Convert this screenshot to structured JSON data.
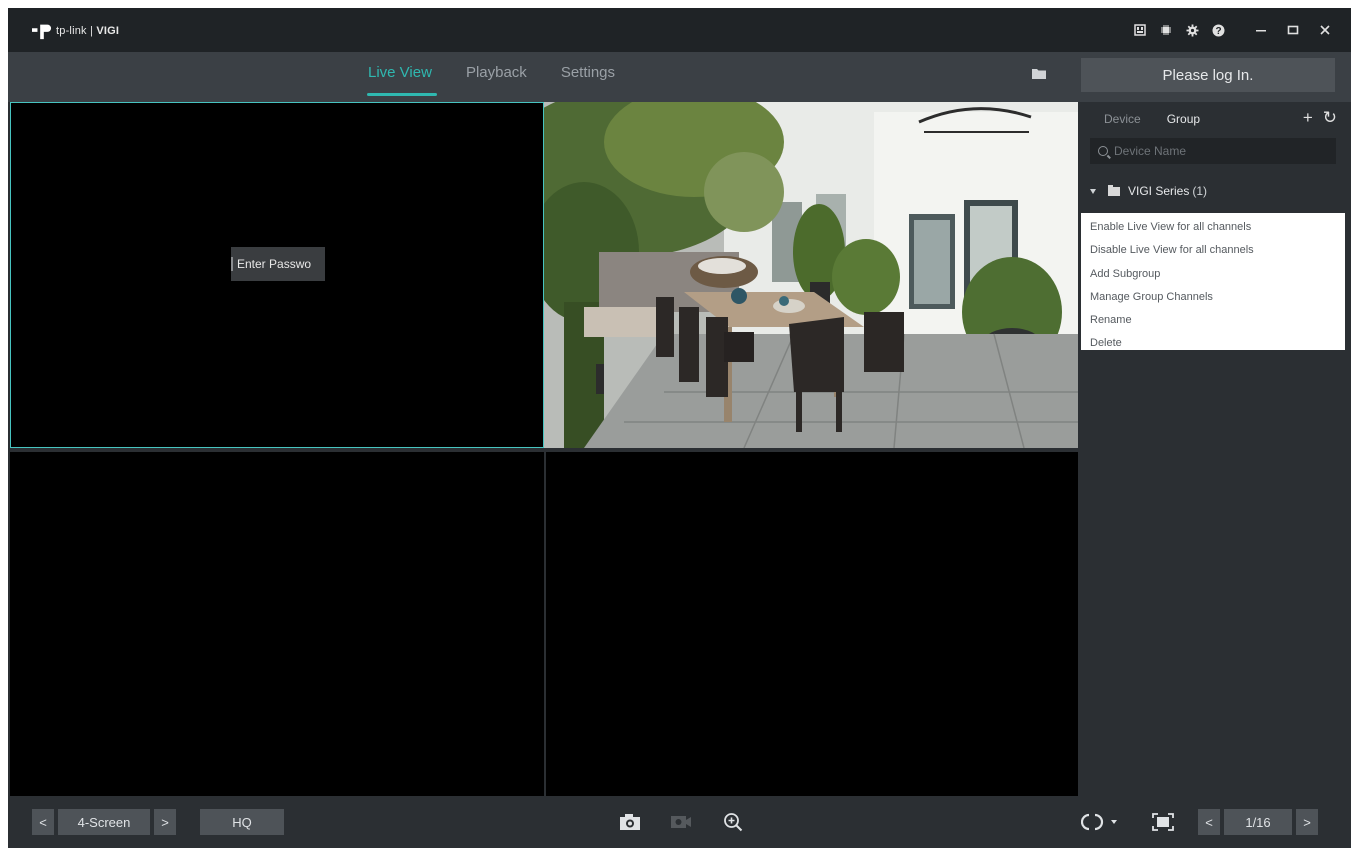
{
  "app": {
    "brand": "tp-link",
    "separator": "|",
    "product": "VIGI"
  },
  "titlebar": {
    "icons": [
      "log-icon",
      "chip-icon",
      "gear-icon",
      "help-icon"
    ],
    "controls": [
      "minimize-icon",
      "maximize-icon",
      "close-icon"
    ]
  },
  "nav": {
    "tabs": [
      {
        "label": "Live View",
        "active": true
      },
      {
        "label": "Playback",
        "active": false
      },
      {
        "label": "Settings",
        "active": false
      }
    ],
    "folder_icon": "folder-icon",
    "login_label": "Please log In."
  },
  "video": {
    "cell1_button": "Enter Passwo"
  },
  "panel": {
    "tabs": [
      {
        "label": "Device",
        "active": false
      },
      {
        "label": "Group",
        "active": true
      }
    ],
    "add_symbol": "+",
    "refresh_symbol": "↻",
    "search_placeholder": "Device Name",
    "group_name": "VIGI Series",
    "group_count": "(1)"
  },
  "context_menu": {
    "items": [
      "Enable Live View for all channels",
      "Disable Live View for all channels",
      "Add Subgroup",
      "Manage Group Channels",
      "Rename",
      "Delete"
    ]
  },
  "bottombar": {
    "prev_symbol": "<",
    "next_symbol": ">",
    "layout_label": "4-Screen",
    "quality_label": "HQ",
    "page_label": "1/16"
  },
  "colors": {
    "accent": "#2fb8b0",
    "selected_border": "#47c4c0",
    "titlebar": "#1f2326",
    "navbar": "#3b4045",
    "body": "#2b2f33"
  }
}
